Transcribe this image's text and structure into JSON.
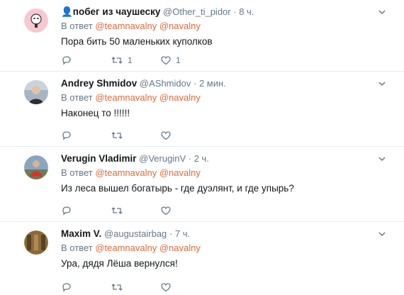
{
  "tweets": [
    {
      "fullname": "👤побег из чаушеску",
      "handle": "@Other_ti_pidor",
      "dot": "·",
      "time": "8 ч.",
      "reply_prefix": "В ответ",
      "mentions": [
        "@teamnavalny",
        "@navalny"
      ],
      "text": "Пора бить 50 маленьких куполков",
      "retweets": "1",
      "likes": "1",
      "avatar_color": "#f7c8d0"
    },
    {
      "fullname": "Andrey Shmidov",
      "handle": "@AShmidov",
      "dot": "·",
      "time": "2 мин.",
      "reply_prefix": "В ответ",
      "mentions": [
        "@teamnavalny",
        "@navalny"
      ],
      "text": "Наконец то !!!!!!",
      "retweets": "",
      "likes": "",
      "avatar_color": "#6b7a8c"
    },
    {
      "fullname": "Verugin Vladimir",
      "handle": "@VeruginV",
      "dot": "·",
      "time": "2 ч.",
      "reply_prefix": "В ответ",
      "mentions": [
        "@teamnavalny",
        "@navalny"
      ],
      "text": "Из леса вышел богатырь - где дуэлянт, и где упырь?",
      "retweets": "",
      "likes": "",
      "avatar_color": "#8aa6bf"
    },
    {
      "fullname": "Maxim V.",
      "handle": "@augustairbag",
      "dot": "·",
      "time": "7 ч.",
      "reply_prefix": "В ответ",
      "mentions": [
        "@teamnavalny",
        "@navalny"
      ],
      "text": "Ура, дядя Лёша вернулся!",
      "retweets": "",
      "likes": "",
      "avatar_color": "#8a6a3a"
    }
  ],
  "icons": {
    "reply": "reply-icon",
    "retweet": "retweet-icon",
    "like": "heart-icon",
    "caret": "chevron-down-icon"
  },
  "colors": {
    "mention": "#e0683a",
    "muted": "#657786",
    "divider": "#e6ecf0"
  }
}
